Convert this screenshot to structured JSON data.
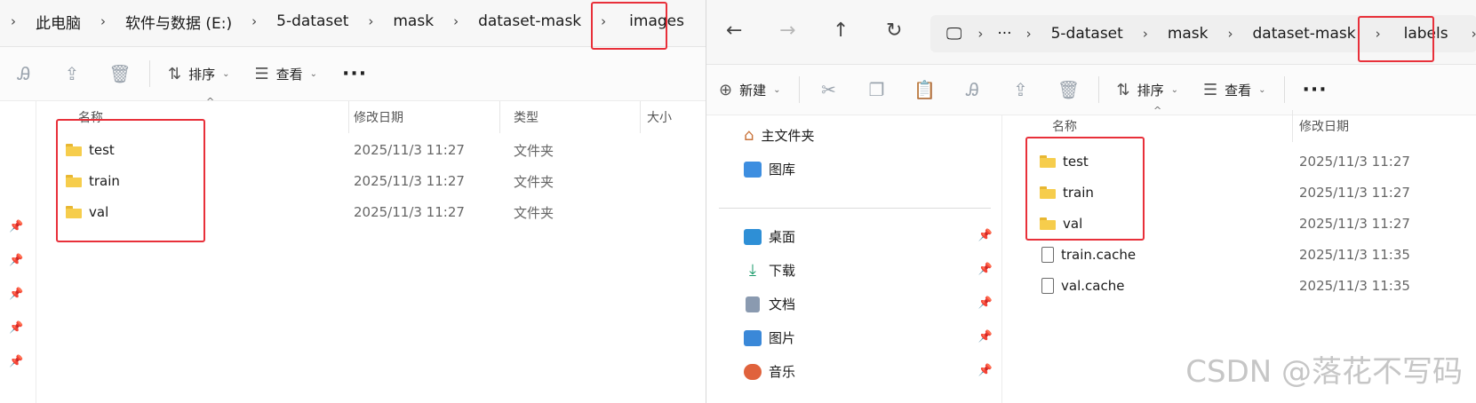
{
  "left_window": {
    "breadcrumb": [
      "此电脑",
      "软件与数据 (E:)",
      "5-dataset",
      "mask",
      "dataset-mask",
      "images"
    ],
    "toolbar": {
      "sort_label": "排序",
      "view_label": "查看"
    },
    "columns": {
      "name": "名称",
      "modified": "修改日期",
      "type": "类型",
      "size": "大小"
    },
    "rows": [
      {
        "name": "test",
        "modified": "2025/11/3 11:27",
        "type": "文件夹"
      },
      {
        "name": "train",
        "modified": "2025/11/3 11:27",
        "type": "文件夹"
      },
      {
        "name": "val",
        "modified": "2025/11/3 11:27",
        "type": "文件夹"
      }
    ]
  },
  "right_window": {
    "breadcrumb": [
      "5-dataset",
      "mask",
      "dataset-mask",
      "labels"
    ],
    "toolbar": {
      "new_label": "新建",
      "sort_label": "排序",
      "view_label": "查看"
    },
    "nav": {
      "home": "主文件夹",
      "gallery": "图库",
      "items": [
        "桌面",
        "下载",
        "文档",
        "图片",
        "音乐"
      ]
    },
    "columns": {
      "name": "名称",
      "modified": "修改日期"
    },
    "rows": [
      {
        "name": "test",
        "modified": "2025/11/3 11:27",
        "kind": "folder"
      },
      {
        "name": "train",
        "modified": "2025/11/3 11:27",
        "kind": "folder"
      },
      {
        "name": "val",
        "modified": "2025/11/3 11:27",
        "kind": "folder"
      },
      {
        "name": "train.cache",
        "modified": "2025/11/3 11:35",
        "kind": "file"
      },
      {
        "name": "val.cache",
        "modified": "2025/11/3 11:35",
        "kind": "file"
      }
    ]
  },
  "watermark": "CSDN @落花不写码",
  "colors": {
    "highlight": "#e8303a",
    "folder": "#f6cd4c"
  }
}
